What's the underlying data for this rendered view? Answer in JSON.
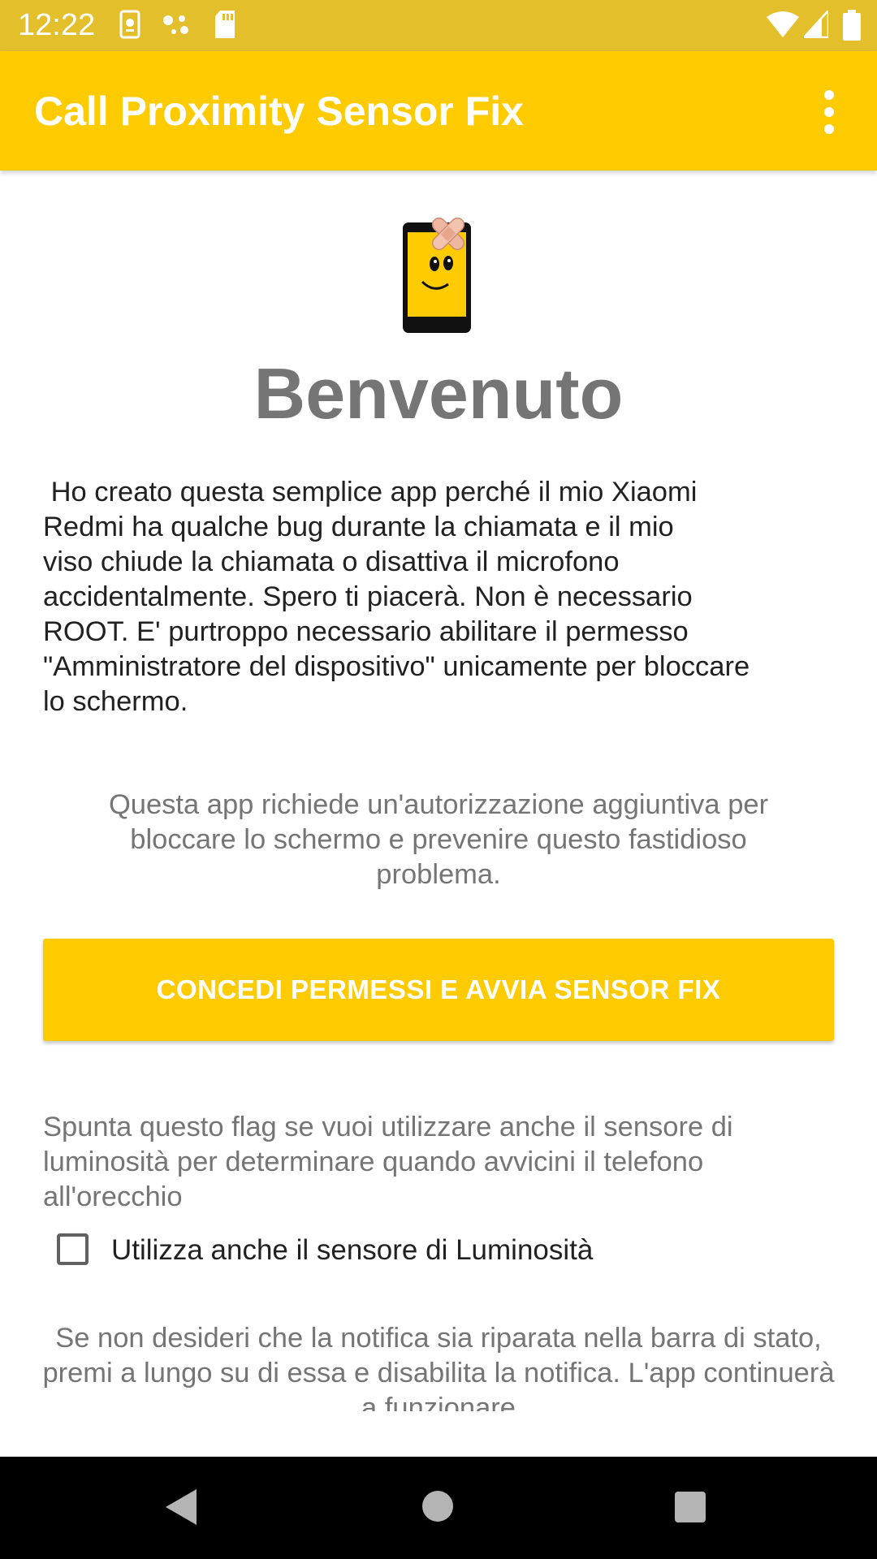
{
  "status_bar": {
    "time": "12:22",
    "icons": [
      "app-notification-icon",
      "assistant-dots-icon",
      "sd-card-icon",
      "wifi-icon",
      "cell-signal-icon",
      "battery-icon"
    ]
  },
  "app_bar": {
    "title": "Call Proximity Sensor Fix",
    "menu_icon": "overflow-menu-icon",
    "background_color": "#fecb00"
  },
  "main": {
    "logo_icon": "phone-smiley-bandage-icon",
    "welcome_title": "Benvenuto",
    "intro_text": " Ho creato questa semplice app perché il mio Xiaomi\nRedmi ha qualche bug durante la chiamata e il mio\nviso chiude la chiamata o disattiva il microfono\naccidentalmente. Spero ti piacerà. Non è necessario\nROOT. E' purtroppo necessario abilitare il permesso\n\"Amministratore del dispositivo\" unicamente per bloccare\nlo schermo.",
    "permission_note": "Questa app richiede un'autorizzazione aggiuntiva per bloccare lo schermo e prevenire questo fastidioso problema.",
    "grant_button_label": "CONCEDI PERMESSI E AVVIA SENSOR FIX",
    "light_sensor_note": "Spunta questo flag se vuoi utilizzare anche il sensore di luminosità per determinare quando avvicini il telefono all'orecchio",
    "light_sensor_checkbox": {
      "label": "Utilizza anche il sensore di Luminosità",
      "checked": false
    },
    "notification_note": "Se non desideri che la notifica sia riparata nella barra di stato, premi a lungo su di essa e disabilita la notifica. L'app continuerà a funzionare"
  },
  "nav_bar": {
    "icons": [
      "back-icon",
      "home-icon",
      "recents-icon"
    ]
  },
  "colors": {
    "status_bar": "#e3bf2c",
    "accent": "#fecb00",
    "title_gray": "#757575"
  }
}
